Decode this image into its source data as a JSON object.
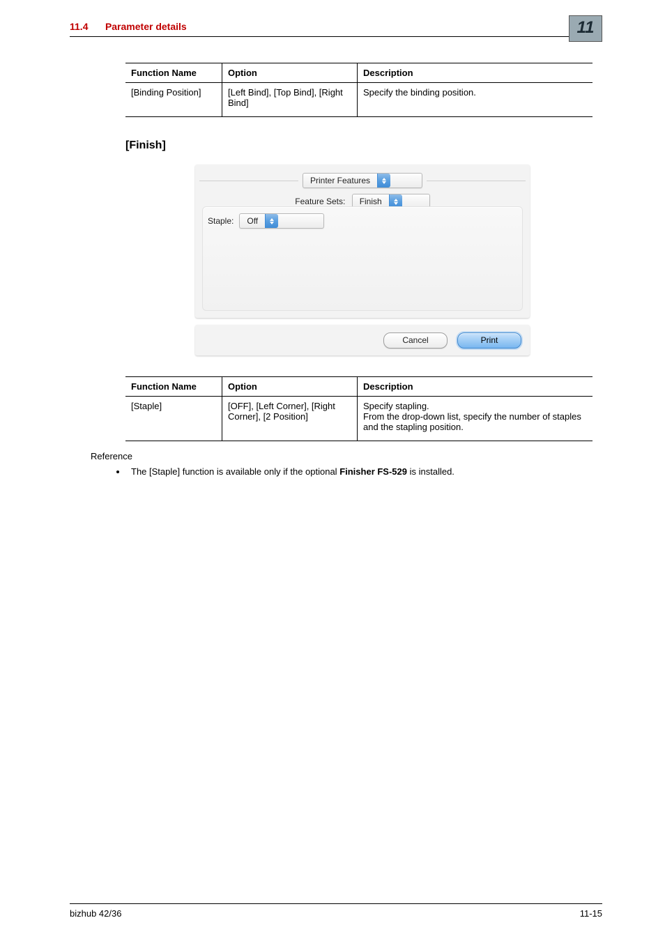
{
  "header": {
    "section_number": "11.4",
    "section_title": "Parameter details",
    "chapter_number": "11"
  },
  "table1": {
    "headers": {
      "fn": "Function Name",
      "op": "Option",
      "desc": "Description"
    },
    "rows": [
      {
        "fn": "[Binding Position]",
        "op": "[Left Bind], [Top Bind], [Right Bind]",
        "desc": "Specify the binding position."
      }
    ]
  },
  "section_heading": "[Finish]",
  "dialog": {
    "main_select": "Printer Features",
    "feature_sets_label": "Feature Sets:",
    "feature_sets_value": "Finish",
    "staple_label": "Staple:",
    "staple_value": "Off",
    "cancel": "Cancel",
    "print": "Print"
  },
  "table2": {
    "headers": {
      "fn": "Function Name",
      "op": "Option",
      "desc": "Description"
    },
    "rows": [
      {
        "fn": "[Staple]",
        "op": "[OFF], [Left Corner], [Right Corner], [2 Position]",
        "desc": "Specify stapling.\nFrom the drop-down list, specify the number of staples and the stapling position."
      }
    ]
  },
  "reference": {
    "heading": "Reference",
    "text_before": "The [Staple] function is available only if the optional ",
    "bold": "Finisher FS-529",
    "text_after": " is installed."
  },
  "footer": {
    "left": "bizhub 42/36",
    "right": "11-15"
  }
}
